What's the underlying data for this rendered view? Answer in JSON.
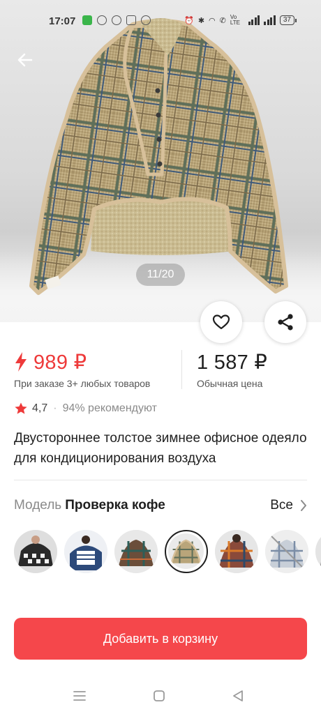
{
  "status_bar": {
    "time": "17:07",
    "battery": "37",
    "volte": "Vo LTE"
  },
  "gallery": {
    "counter": "11/20",
    "current_index": 11,
    "total": 20
  },
  "actions": {
    "back_icon": "arrow-left-icon",
    "like_icon": "heart-outline-icon",
    "share_icon": "share-icon"
  },
  "prices": {
    "deal_price": "989 ₽",
    "deal_note": "При заказе 3+ любых товаров",
    "deal_icon": "lightning-icon",
    "regular_price": "1 587 ₽",
    "regular_note": "Обычная цена"
  },
  "rating": {
    "score": "4,7",
    "separator": "·",
    "recommend": "94% рекомендуют"
  },
  "product": {
    "title": "Двустороннее толстое зимнее офисное одеяло для кондиционирования воздуха"
  },
  "model": {
    "label": "Модель",
    "value": "Проверка кофе",
    "all_label": "Все",
    "selected_index": 3,
    "variant_count": 7
  },
  "cart": {
    "label": "Добавить в корзину"
  },
  "colors": {
    "accent_red": "#ee3a3a",
    "button_red": "#f5474b",
    "text_gray": "#8a8a8a"
  }
}
